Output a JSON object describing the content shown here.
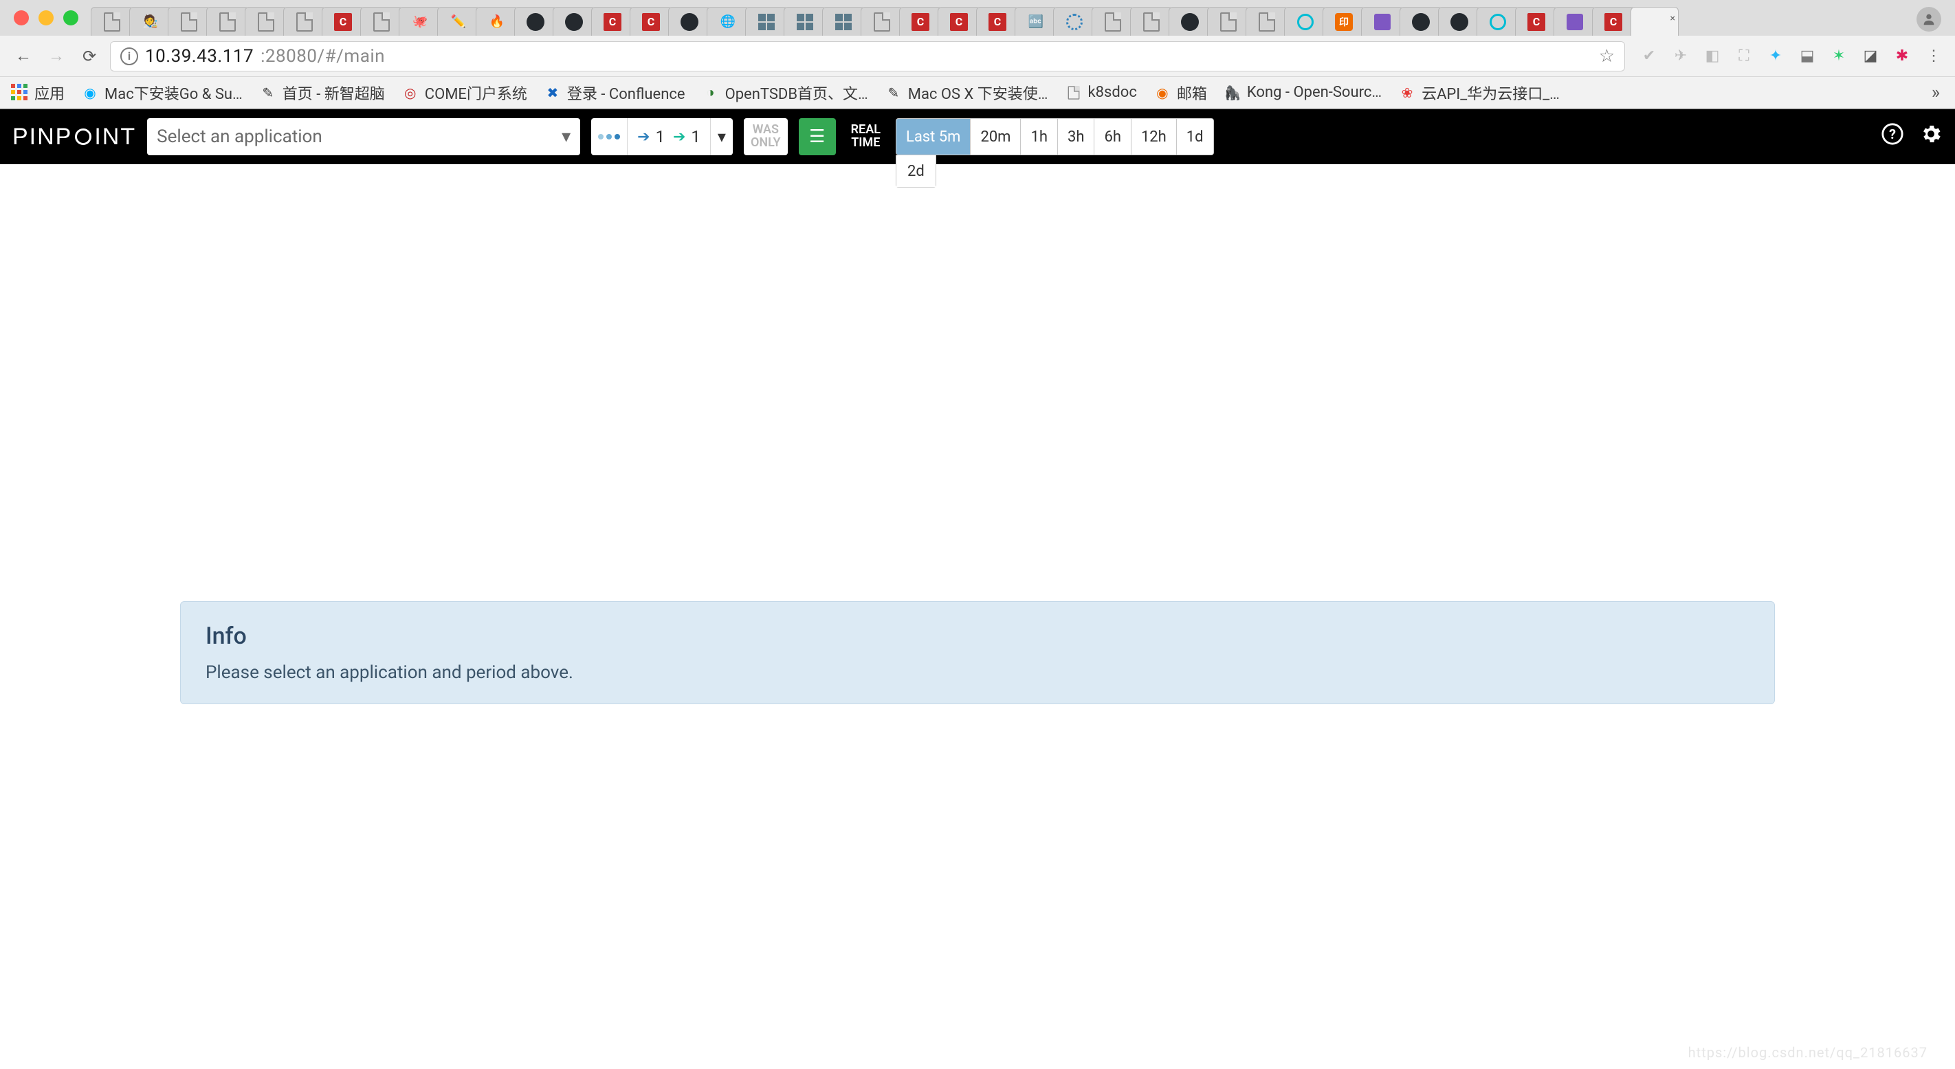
{
  "browser": {
    "url_host": "10.39.43.117",
    "url_path": ":28080/#/main",
    "bookmarks": [
      {
        "label": "应用",
        "icon": "apps"
      },
      {
        "label": "Mac下安装Go & Su…",
        "icon": "edge"
      },
      {
        "label": "首页 - 新智超脑",
        "icon": "edit"
      },
      {
        "label": "COME门户系统",
        "icon": "red-dot"
      },
      {
        "label": "登录 - Confluence",
        "icon": "conf"
      },
      {
        "label": "OpenTSDB首页、文…",
        "icon": "green-c"
      },
      {
        "label": "Mac OS X 下安装使…",
        "icon": "edit"
      },
      {
        "label": "k8sdoc",
        "icon": "doc"
      },
      {
        "label": "邮箱",
        "icon": "mail"
      },
      {
        "label": "Kong - Open-Sourc…",
        "icon": "kong"
      },
      {
        "label": "云API_华为云接口_…",
        "icon": "huawei"
      }
    ]
  },
  "pinpoint": {
    "logo_text": "PINPOINT",
    "app_select_placeholder": "Select an application",
    "calls": {
      "in": "1",
      "out": "1"
    },
    "was_only_line1": "WAS",
    "was_only_line2": "ONLY",
    "realtime_line1": "REAL",
    "realtime_line2": "TIME",
    "time_ranges": [
      "Last 5m",
      "20m",
      "1h",
      "3h",
      "6h",
      "12h",
      "1d"
    ],
    "time_ranges_row2": [
      "2d"
    ],
    "time_active_index": 0
  },
  "info": {
    "title": "Info",
    "body": "Please select an application and period above."
  },
  "watermark": "https://blog.csdn.net/qq_21816637"
}
